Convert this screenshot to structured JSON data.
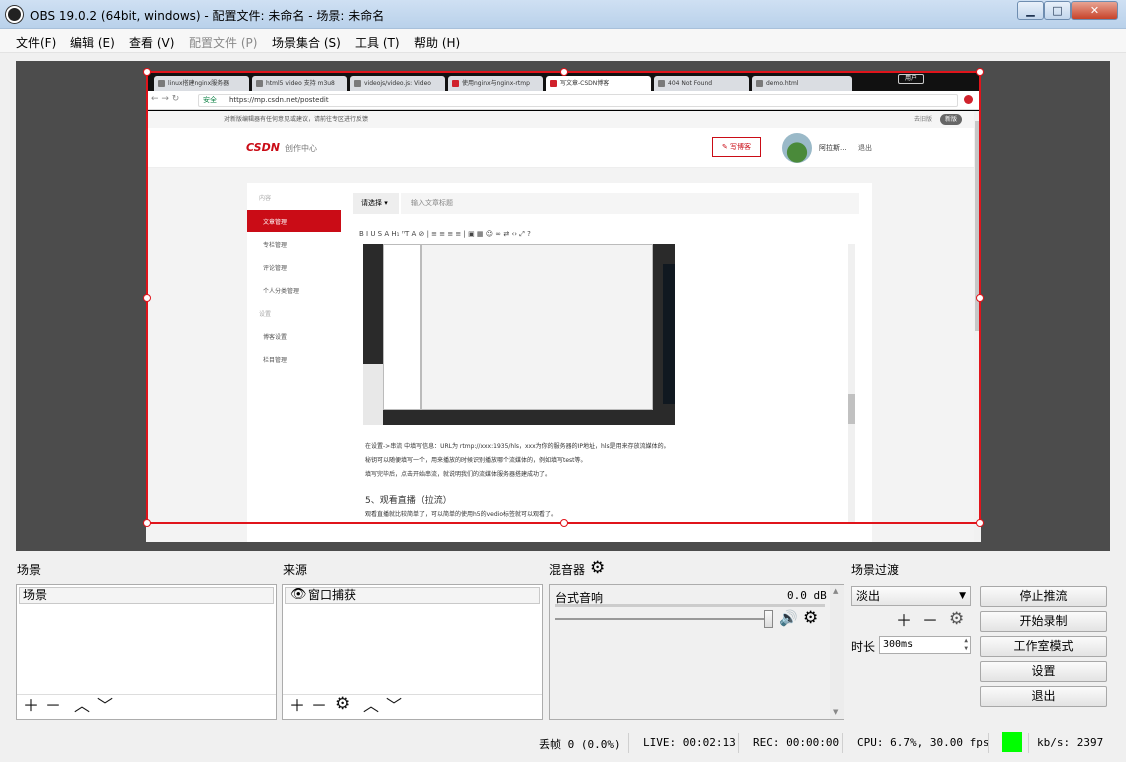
{
  "window": {
    "title": "OBS 19.0.2 (64bit, windows) - 配置文件: 未命名 - 场景: 未命名",
    "minimize": "▁",
    "maximize": "□",
    "close": "✕"
  },
  "menu": [
    "文件(F)",
    "编辑 (E)",
    "查看 (V)",
    "配置文件 (P)",
    "场景集合 (S)",
    "工具 (T)",
    "帮助 (H)"
  ],
  "browser": {
    "tabs": [
      "linux搭建nginx服务器",
      "html5 video 支持 m3u8",
      "videojs/video.js: Video",
      "使用nginx与nginx-rtmp",
      "写文章-CSDN博客",
      "404 Not Found",
      "demo.html"
    ],
    "user_badge": "用户",
    "secure": "安全",
    "url": "https://mp.csdn.net/postedit",
    "notice": "对新版编辑器有任何意见或建议，请前往专区进行反馈",
    "notice_right": "去旧版",
    "notice_btn": "新版",
    "logo": "CSDN",
    "logo_sub": "创作中心",
    "write_btn": "写博客",
    "user_name": "阿拉斯...",
    "logout": "退出",
    "nav_group1": "内容",
    "nav_items1": [
      "文章管理",
      "专栏管理",
      "评论管理",
      "个人分类管理"
    ],
    "nav_group2": "设置",
    "nav_items2": [
      "博客设置",
      "栏目管理"
    ],
    "category_select": "请选择",
    "title_placeholder": "输入文章标题",
    "toolbar": "B  I  U  S  A  H₁  ᴴT  A  ⊘  |  ≡  ≡  ≡  ≡  |  ▣  ▦  ☺  ∞  ⇄  ‹›  ⤢  ?",
    "text_lines": [
      "在设置->串流 中填写信息：URL为 rtmp://xxx:1935/hls，xxx为你的服务器的IP地址，hls是用来存放流媒体的。",
      "秘钥可以随便填写一个，用来播放的时候识别播放哪个流媒体的，例如填写test等。",
      "填写完毕后，点击开始串流，就说明我们的流媒体服务器搭建成功了。"
    ],
    "heading": "5、观看直播（拉流）",
    "text_after": "观看直播就比较简单了，可以简单的使用h5的vedio标签就可以观看了。"
  },
  "panels": {
    "scenes_title": "场景",
    "scene_item": "场景",
    "sources_title": "来源",
    "source_item": "窗口捕获",
    "mixer_title": "混音器",
    "mixer_track": "台式音响",
    "mixer_db": "0.0 dB",
    "transitions_title": "场景过渡",
    "transition_select": "淡出",
    "duration_label": "时长",
    "duration_value": "300ms"
  },
  "controls": [
    "停止推流",
    "开始录制",
    "工作室模式",
    "设置",
    "退出"
  ],
  "status": {
    "dropped": "丢帧 0 (0.0%)",
    "live": "LIVE: 00:02:13",
    "rec": "REC: 00:00:00",
    "cpu": "CPU: 6.7%, 30.00 fps",
    "kbps": "kb/s: 2397",
    "indicator_color": "#00ff00"
  },
  "colors": {
    "accent": "#e0141b",
    "csdn_red": "#ca0c16"
  }
}
